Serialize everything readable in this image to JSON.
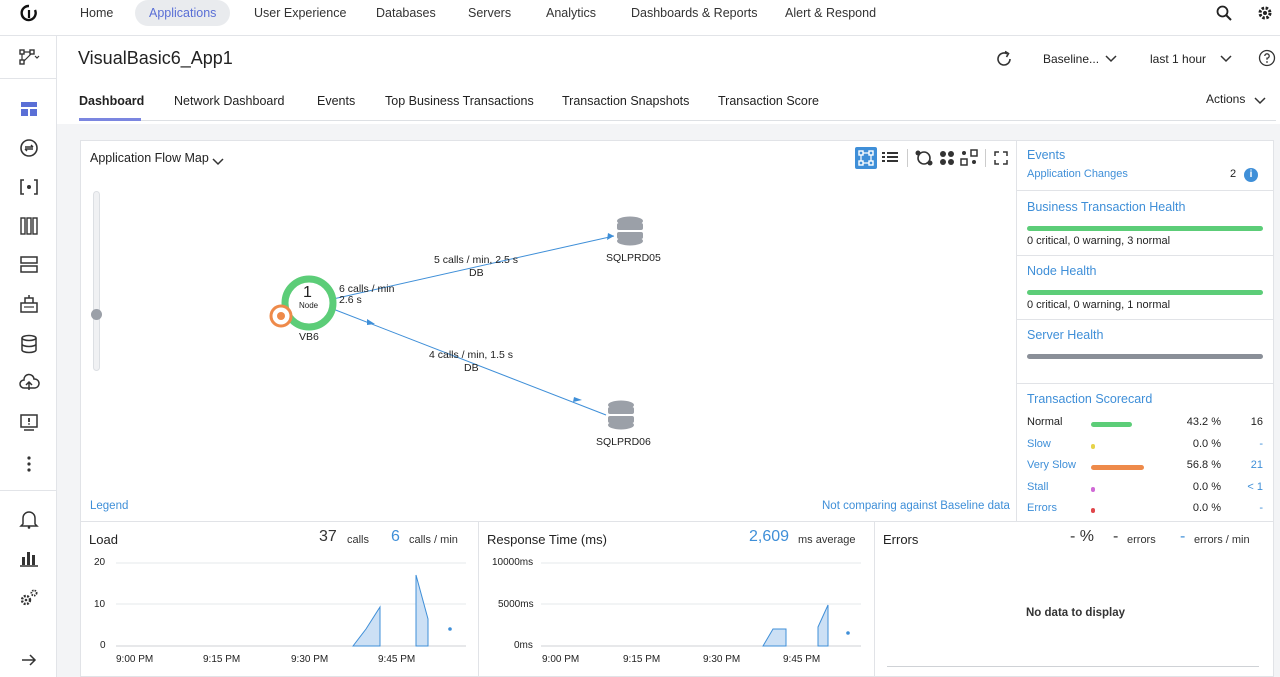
{
  "topnav": {
    "items": [
      "Home",
      "Applications",
      "User Experience",
      "Databases",
      "Servers",
      "Analytics",
      "Dashboards & Reports",
      "Alert & Respond"
    ]
  },
  "header": {
    "title": "VisualBasic6_App1",
    "baseline": "Baseline...",
    "time_range": "last 1 hour"
  },
  "tabs": [
    "Dashboard",
    "Network Dashboard",
    "Events",
    "Top Business Transactions",
    "Transaction Snapshots",
    "Transaction Score"
  ],
  "actions_label": "Actions",
  "flowmap": {
    "title": "Application Flow Map",
    "legend": "Legend",
    "baseline_note": "Not comparing against Baseline data",
    "node": {
      "count": "1",
      "label": "Node",
      "name": "VB6",
      "self_calls": "6 calls / min",
      "self_time": "2.6 s"
    },
    "db1": {
      "name": "SQLPRD05",
      "calls": "5 calls / min, 2.5 s",
      "type": "DB"
    },
    "db2": {
      "name": "SQLPRD06",
      "calls": "4 calls / min, 1.5 s",
      "type": "DB"
    }
  },
  "side": {
    "events_title": "Events",
    "app_changes_label": "Application Changes",
    "app_changes_count": "2",
    "bt_health_title": "Business Transaction Health",
    "bt_health_text": "0 critical, 0 warning, 3 normal",
    "node_health_title": "Node Health",
    "node_health_text": "0 critical, 0 warning, 1 normal",
    "server_health_title": "Server Health",
    "scorecard_title": "Transaction Scorecard",
    "scorecard": [
      {
        "label": "Normal",
        "pct": "43.2 %",
        "count": "16",
        "color": "#5ccd78",
        "fraction": 0.432
      },
      {
        "label": "Slow",
        "pct": "0.0 %",
        "count": "-",
        "color": "#e6d34a",
        "fraction": 0.0
      },
      {
        "label": "Very Slow",
        "pct": "56.8 %",
        "count": "21",
        "color": "#ee8a4a",
        "fraction": 0.568
      },
      {
        "label": "Stall",
        "pct": "0.0 %",
        "count": "< 1",
        "color": "#d06ad6",
        "fraction": 0.0
      },
      {
        "label": "Errors",
        "pct": "0.0 %",
        "count": "-",
        "color": "#e0464b",
        "fraction": 0.0
      }
    ],
    "colors": {
      "health_green": "#5ccd78",
      "server_gray": "#8a8f98",
      "link_blue": "#3f8fd8"
    }
  },
  "load": {
    "title": "Load",
    "calls": "37",
    "calls_unit": "calls",
    "rate": "6",
    "rate_unit": "calls / min",
    "yticks": [
      "20",
      "10",
      "0"
    ],
    "xticks": [
      "9:00 PM",
      "9:15 PM",
      "9:30 PM",
      "9:45 PM"
    ]
  },
  "response": {
    "title": "Response Time (ms)",
    "avg": "2,609",
    "avg_unit": "ms average",
    "yticks": [
      "10000ms",
      "5000ms",
      "0ms"
    ],
    "xticks": [
      "9:00 PM",
      "9:15 PM",
      "9:30 PM",
      "9:45 PM"
    ]
  },
  "errors": {
    "title": "Errors",
    "pct": "- %",
    "count": "-",
    "count_unit": "errors",
    "rate": "-",
    "rate_unit": "errors / min",
    "no_data": "No data to display"
  }
}
